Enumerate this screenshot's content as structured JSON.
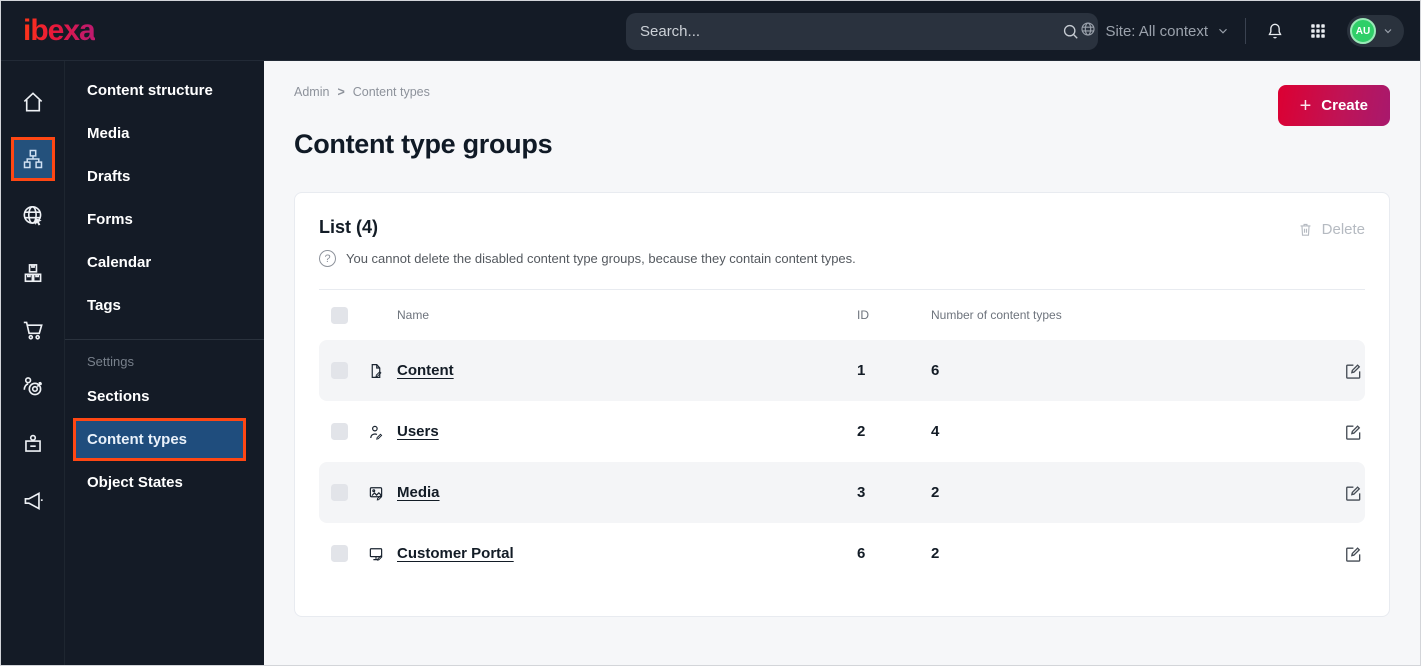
{
  "topbar": {
    "logo_text": "ibexa",
    "search_placeholder": "Search...",
    "site_context_label": "Site: All context",
    "avatar_initials": "AU",
    "icons": [
      "site-globe-icon",
      "chevron-down-icon",
      "bell-icon",
      "app-grid-icon"
    ]
  },
  "rail": {
    "icons": [
      "home-icon",
      "content-tree-icon",
      "globe-cursor-icon",
      "packages-icon",
      "cart-icon",
      "personalization-target-icon",
      "badge-icon",
      "megaphone-icon"
    ],
    "selected_index": 1
  },
  "sidebar": {
    "items": [
      "Content structure",
      "Media",
      "Drafts",
      "Forms",
      "Calendar",
      "Tags"
    ],
    "settings_label": "Settings",
    "settings_items": [
      "Sections",
      "Content types",
      "Object States"
    ],
    "selected": "Content types"
  },
  "breadcrumb": {
    "crumb1": "Admin",
    "separator": ">",
    "crumb2": "Content types"
  },
  "page": {
    "title": "Content type groups",
    "create_label": "Create",
    "create_plus": "+"
  },
  "card": {
    "title": "List (4)",
    "delete_label": "Delete",
    "info_text": "You cannot delete the disabled content type groups, because they contain content types.",
    "help_glyph": "?",
    "table": {
      "columns": {
        "name": "Name",
        "id": "ID",
        "count": "Number of content types"
      },
      "rows": [
        {
          "name": "Content",
          "icon": "file-edit-icon",
          "id": "1",
          "count": "6"
        },
        {
          "name": "Users",
          "icon": "user-edit-icon",
          "id": "2",
          "count": "4"
        },
        {
          "name": "Media",
          "icon": "image-edit-icon",
          "id": "3",
          "count": "2"
        },
        {
          "name": "Customer Portal",
          "icon": "monitor-edit-icon",
          "id": "6",
          "count": "2"
        }
      ]
    }
  },
  "colors": {
    "topbar_bg": "#141b26",
    "accent_orange": "#ff4713",
    "selected_blue": "#24517c",
    "create_gradient": [
      "#dc0032",
      "#a8196d"
    ],
    "avatar_green": "#2fcf68",
    "row_shade": "#f4f5f7"
  }
}
